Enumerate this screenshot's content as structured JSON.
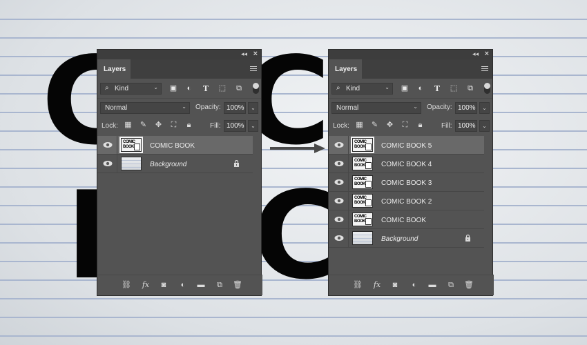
{
  "background": {
    "big_text_top": "CMC",
    "big_text_bottom": "BOC"
  },
  "panels": [
    {
      "title": "Layers",
      "filter": {
        "kind_label": "Kind",
        "icons": [
          "image-filter-icon",
          "adjustment-filter-icon",
          "type-filter-icon",
          "shape-filter-icon",
          "smart-object-filter-icon"
        ]
      },
      "blend_mode": "Normal",
      "opacity_label": "Opacity:",
      "opacity_value": "100%",
      "lock_label": "Lock:",
      "fill_label": "Fill:",
      "fill_value": "100%",
      "layers": [
        {
          "name": "COMIC BOOK",
          "type": "text-smart",
          "selected": true
        },
        {
          "name": "Background",
          "type": "background",
          "locked": true
        }
      ]
    },
    {
      "title": "Layers",
      "filter": {
        "kind_label": "Kind"
      },
      "blend_mode": "Normal",
      "opacity_label": "Opacity:",
      "opacity_value": "100%",
      "lock_label": "Lock:",
      "fill_label": "Fill:",
      "fill_value": "100%",
      "layers": [
        {
          "name": "COMIC BOOK 5",
          "type": "text-smart",
          "selected": true
        },
        {
          "name": "COMIC BOOK 4",
          "type": "text-smart"
        },
        {
          "name": "COMIC BOOK 3",
          "type": "text-smart"
        },
        {
          "name": "COMIC BOOK 2",
          "type": "text-smart"
        },
        {
          "name": "COMIC BOOK",
          "type": "text-smart"
        },
        {
          "name": "Background",
          "type": "background",
          "locked": true
        }
      ]
    }
  ],
  "thumb_text": "COMIC BOOK",
  "colors": {
    "panel": "#535353",
    "selected_row": "#696969",
    "text": "#ececec"
  }
}
